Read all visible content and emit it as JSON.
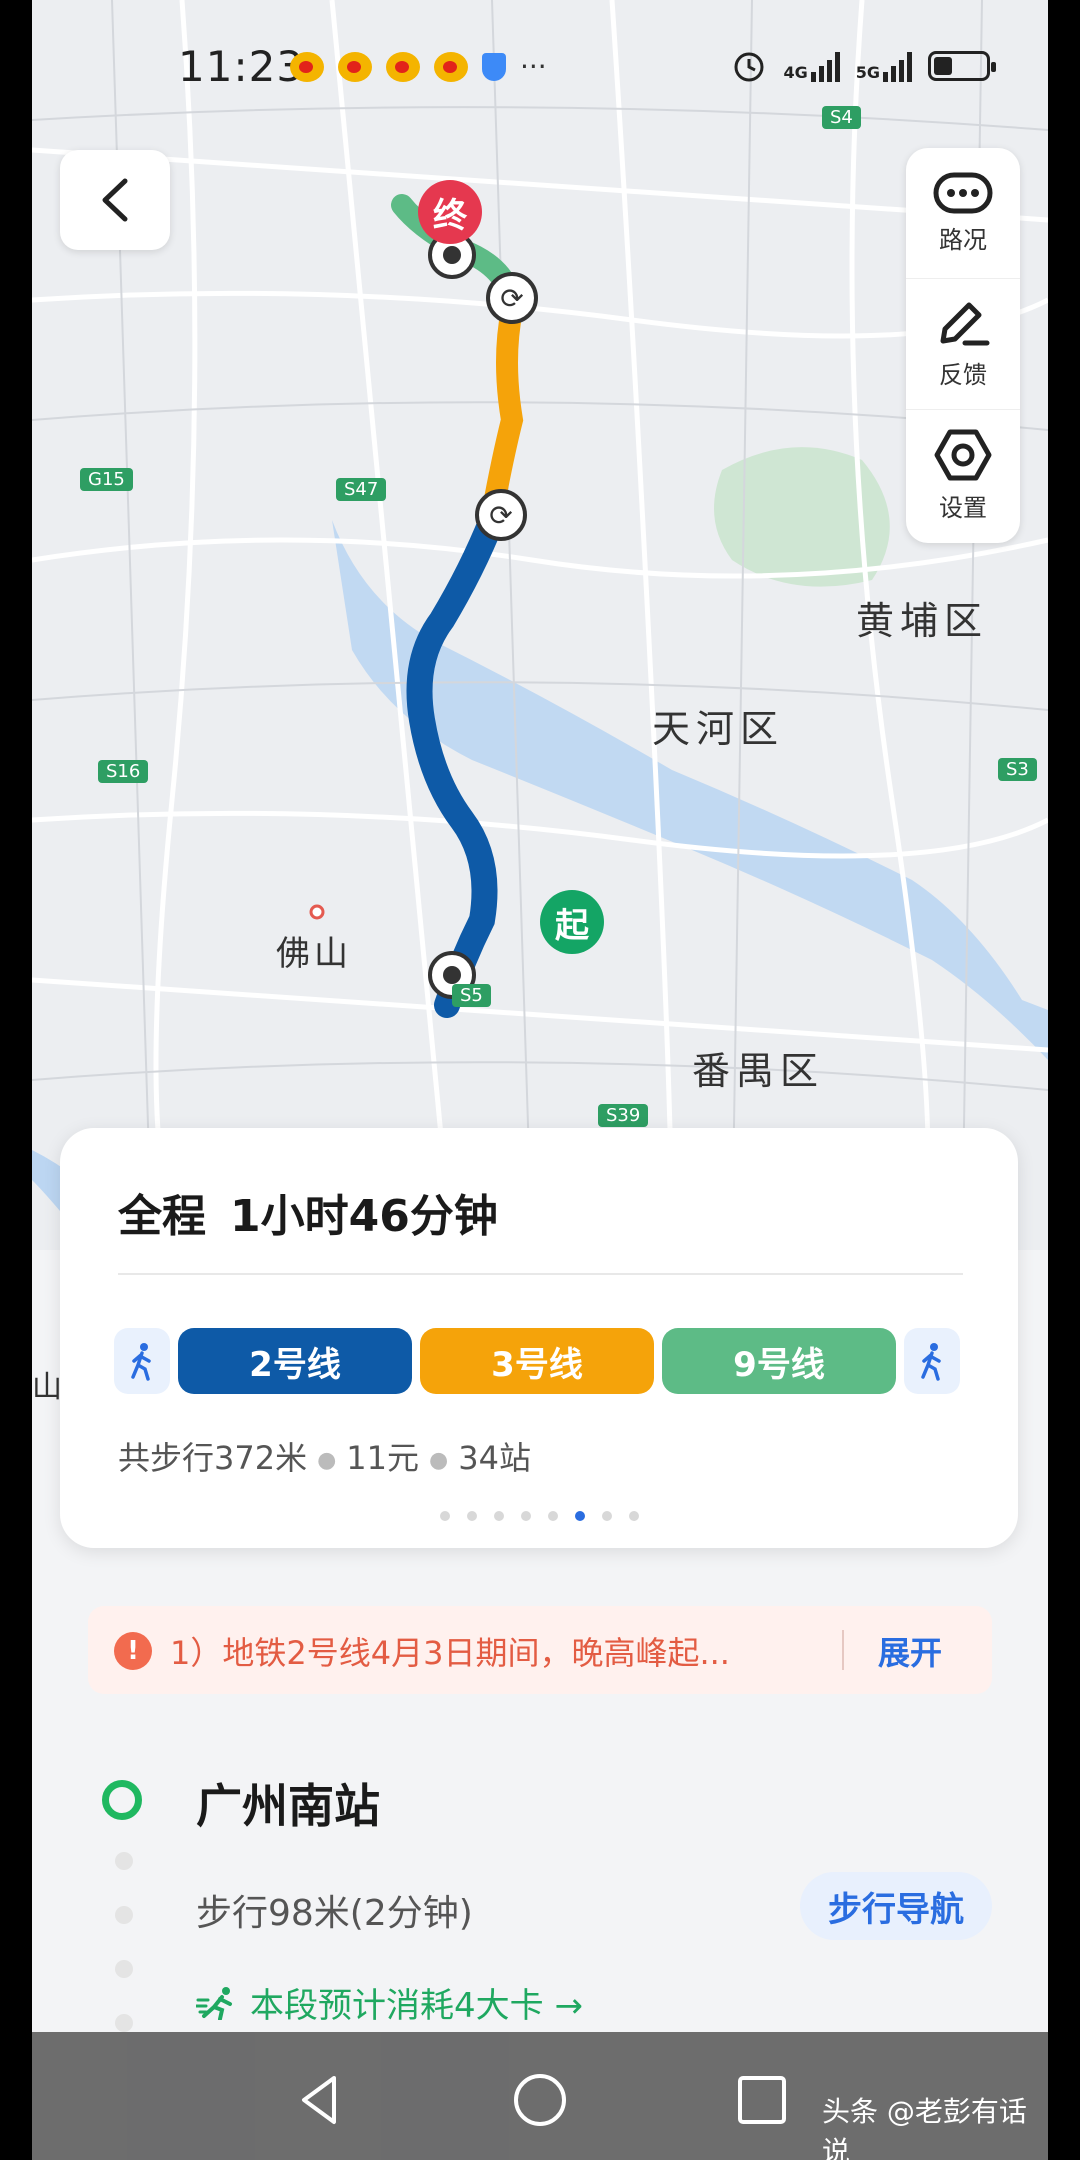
{
  "status": {
    "time": "11:23",
    "net1": "4G",
    "net2": "5G",
    "icons": [
      "weibo-icon",
      "weibo-icon",
      "weibo-icon",
      "weibo-icon",
      "shield-icon"
    ],
    "more": "···"
  },
  "map": {
    "end_marker": "终",
    "start_marker": "起",
    "labels": {
      "huangpu": "黄埔区",
      "tianhe": "天河区",
      "foshan": "佛山",
      "panyu": "番禺区",
      "shan": "山"
    },
    "road_shields": [
      "S4",
      "G15",
      "S47",
      "S16",
      "S3",
      "S5",
      "S39"
    ],
    "route_colors": {
      "line2": "#0e5aa7",
      "line3": "#f5a30a",
      "line9": "#5dbb86"
    }
  },
  "tools": [
    {
      "label": "路况",
      "icon": "traffic-icon"
    },
    {
      "label": "反馈",
      "icon": "edit-icon"
    },
    {
      "label": "设置",
      "icon": "settings-icon"
    }
  ],
  "route": {
    "prefix": "全程",
    "duration": "1小时46分钟",
    "lines": [
      {
        "name": "2号线",
        "color": "#0e5aa7"
      },
      {
        "name": "3号线",
        "color": "#f5a30a"
      },
      {
        "name": "9号线",
        "color": "#5dbb86"
      }
    ],
    "walk": "共步行372米",
    "fare": "11元",
    "stops": "34站"
  },
  "alert": {
    "text": "1）地铁2号线4月3日期间，晚高峰起...",
    "action": "展开"
  },
  "station": {
    "name": "广州南站",
    "walk_info": "步行98米(2分钟)",
    "walk_nav": "步行导航",
    "calorie": "本段预计消耗4大卡 →"
  },
  "watermark": "头条 @老彭有话说"
}
